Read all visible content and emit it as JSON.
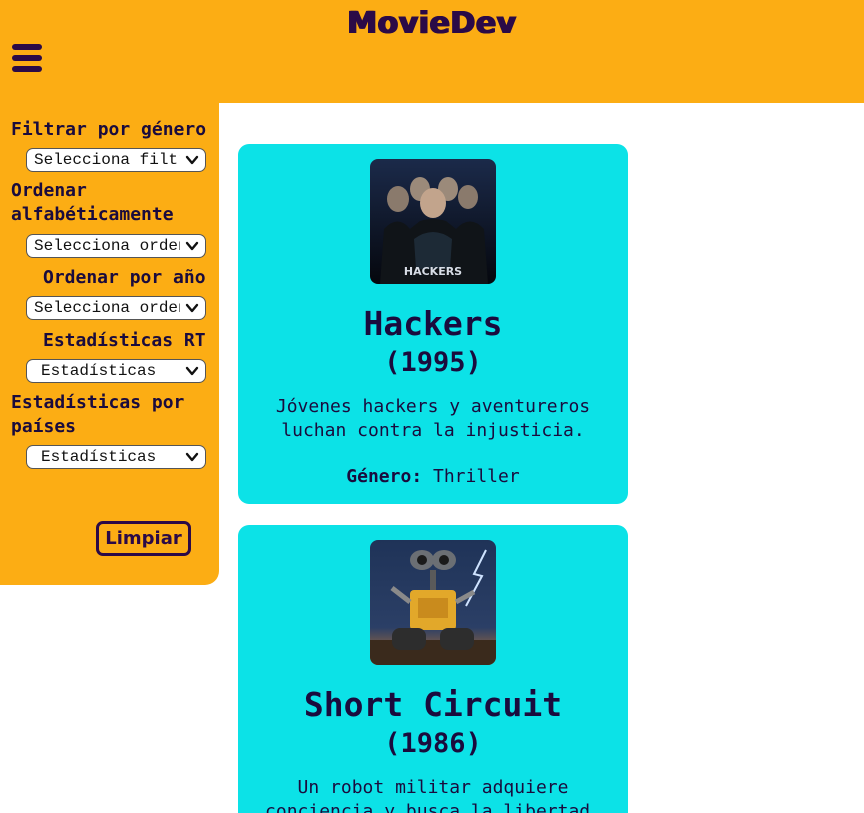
{
  "header": {
    "title": "MovieDev",
    "menu_icon": "hamburger-menu-icon"
  },
  "colors": {
    "header_bg": "#fcad14",
    "card_bg": "#0ce2e7",
    "text_dark": "#2b0a47"
  },
  "sidebar": {
    "genre_label": "Filtrar por género",
    "genre_select": "Selecciona filtro",
    "alpha_label": "Ordenar alfabéticamente",
    "alpha_select": "Selecciona orden",
    "year_label": "Ordenar por año",
    "year_select": "Selecciona orden",
    "rt_label": "Estadísticas RT",
    "rt_select": "Estadísticas",
    "country_label": "Estadísticas por países",
    "country_select": "Estadísticas",
    "clear_label": "Limpiar"
  },
  "movies": [
    {
      "title": "Hackers",
      "year": "(1995)",
      "description": "Jóvenes hackers y aventureros luchan contra la injusticia.",
      "genre_label": "Género:",
      "genre": "Thriller",
      "poster_text": "HACKERS"
    },
    {
      "title": "Short Circuit",
      "year": "(1986)",
      "description": "Un robot militar adquiere conciencia y busca la libertad.",
      "genre_label": "",
      "genre": "",
      "poster_text": ""
    }
  ]
}
